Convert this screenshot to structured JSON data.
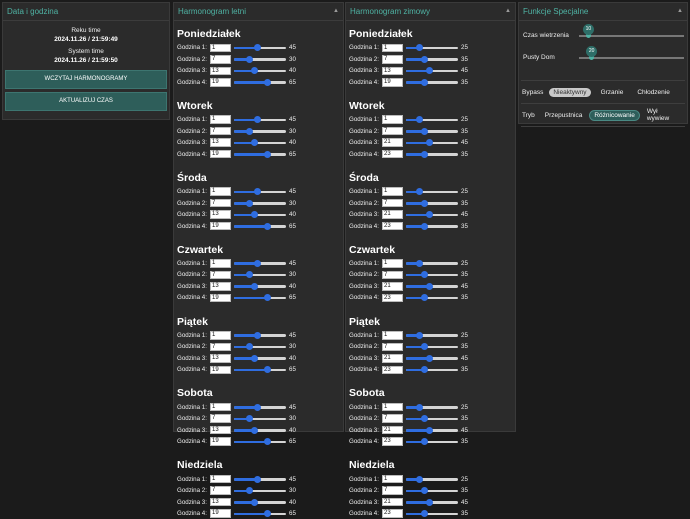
{
  "datetime": {
    "header": "Data i godzina",
    "reku_label": "Reku time",
    "reku_value": "2024.11.26 / 21:59:49",
    "system_label": "System time",
    "system_value": "2024.11.26 / 21:59:50",
    "load_button": "WCZYTAJ HARMONOGRAMY",
    "update_button": "AKTUALIZUJ CZAS"
  },
  "summer": {
    "header": "Harmonogram letni",
    "days": [
      {
        "name": "Poniedziałek",
        "rows": [
          {
            "label": "Godzina 1:",
            "hour": "1",
            "value": "45"
          },
          {
            "label": "Godzina 2:",
            "hour": "7",
            "value": "30"
          },
          {
            "label": "Godzina 3:",
            "hour": "13",
            "value": "40"
          },
          {
            "label": "Godzina 4:",
            "hour": "19",
            "value": "65"
          }
        ]
      },
      {
        "name": "Wtorek",
        "rows": [
          {
            "label": "Godzina 1:",
            "hour": "1",
            "value": "45"
          },
          {
            "label": "Godzina 2:",
            "hour": "7",
            "value": "30"
          },
          {
            "label": "Godzina 3:",
            "hour": "13",
            "value": "40"
          },
          {
            "label": "Godzina 4:",
            "hour": "19",
            "value": "65"
          }
        ]
      },
      {
        "name": "Środa",
        "rows": [
          {
            "label": "Godzina 1:",
            "hour": "1",
            "value": "45"
          },
          {
            "label": "Godzina 2:",
            "hour": "7",
            "value": "30"
          },
          {
            "label": "Godzina 3:",
            "hour": "13",
            "value": "40"
          },
          {
            "label": "Godzina 4:",
            "hour": "19",
            "value": "65"
          }
        ]
      },
      {
        "name": "Czwartek",
        "rows": [
          {
            "label": "Godzina 1:",
            "hour": "1",
            "value": "45"
          },
          {
            "label": "Godzina 2:",
            "hour": "7",
            "value": "30"
          },
          {
            "label": "Godzina 3:",
            "hour": "13",
            "value": "40"
          },
          {
            "label": "Godzina 4:",
            "hour": "19",
            "value": "65"
          }
        ]
      },
      {
        "name": "Piątek",
        "rows": [
          {
            "label": "Godzina 1:",
            "hour": "1",
            "value": "45"
          },
          {
            "label": "Godzina 2:",
            "hour": "7",
            "value": "30"
          },
          {
            "label": "Godzina 3:",
            "hour": "13",
            "value": "40"
          },
          {
            "label": "Godzina 4:",
            "hour": "19",
            "value": "65"
          }
        ]
      },
      {
        "name": "Sobota",
        "rows": [
          {
            "label": "Godzina 1:",
            "hour": "1",
            "value": "45"
          },
          {
            "label": "Godzina 2:",
            "hour": "7",
            "value": "30"
          },
          {
            "label": "Godzina 3:",
            "hour": "13",
            "value": "40"
          },
          {
            "label": "Godzina 4:",
            "hour": "19",
            "value": "65"
          }
        ]
      },
      {
        "name": "Niedziela",
        "rows": [
          {
            "label": "Godzina 1:",
            "hour": "1",
            "value": "45"
          },
          {
            "label": "Godzina 2:",
            "hour": "7",
            "value": "30"
          },
          {
            "label": "Godzina 3:",
            "hour": "13",
            "value": "40"
          },
          {
            "label": "Godzina 4:",
            "hour": "19",
            "value": "65"
          }
        ]
      }
    ]
  },
  "winter": {
    "header": "Harmonogram zimowy",
    "days": [
      {
        "name": "Poniedziałek",
        "rows": [
          {
            "label": "Godzina 1:",
            "hour": "1",
            "value": "25"
          },
          {
            "label": "Godzina 2:",
            "hour": "7",
            "value": "35"
          },
          {
            "label": "Godzina 3:",
            "hour": "13",
            "value": "45"
          },
          {
            "label": "Godzina 4:",
            "hour": "19",
            "value": "35"
          }
        ]
      },
      {
        "name": "Wtorek",
        "rows": [
          {
            "label": "Godzina 1:",
            "hour": "1",
            "value": "25"
          },
          {
            "label": "Godzina 2:",
            "hour": "7",
            "value": "35"
          },
          {
            "label": "Godzina 3:",
            "hour": "21",
            "value": "45"
          },
          {
            "label": "Godzina 4:",
            "hour": "23",
            "value": "35"
          }
        ]
      },
      {
        "name": "Środa",
        "rows": [
          {
            "label": "Godzina 1:",
            "hour": "1",
            "value": "25"
          },
          {
            "label": "Godzina 2:",
            "hour": "7",
            "value": "35"
          },
          {
            "label": "Godzina 3:",
            "hour": "21",
            "value": "45"
          },
          {
            "label": "Godzina 4:",
            "hour": "23",
            "value": "35"
          }
        ]
      },
      {
        "name": "Czwartek",
        "rows": [
          {
            "label": "Godzina 1:",
            "hour": "1",
            "value": "25"
          },
          {
            "label": "Godzina 2:",
            "hour": "7",
            "value": "35"
          },
          {
            "label": "Godzina 3:",
            "hour": "21",
            "value": "45"
          },
          {
            "label": "Godzina 4:",
            "hour": "23",
            "value": "35"
          }
        ]
      },
      {
        "name": "Piątek",
        "rows": [
          {
            "label": "Godzina 1:",
            "hour": "1",
            "value": "25"
          },
          {
            "label": "Godzina 2:",
            "hour": "7",
            "value": "35"
          },
          {
            "label": "Godzina 3:",
            "hour": "21",
            "value": "45"
          },
          {
            "label": "Godzina 4:",
            "hour": "23",
            "value": "35"
          }
        ]
      },
      {
        "name": "Sobota",
        "rows": [
          {
            "label": "Godzina 1:",
            "hour": "1",
            "value": "25"
          },
          {
            "label": "Godzina 2:",
            "hour": "7",
            "value": "35"
          },
          {
            "label": "Godzina 3:",
            "hour": "21",
            "value": "45"
          },
          {
            "label": "Godzina 4:",
            "hour": "23",
            "value": "35"
          }
        ]
      },
      {
        "name": "Niedziela",
        "rows": [
          {
            "label": "Godzina 1:",
            "hour": "1",
            "value": "25"
          },
          {
            "label": "Godzina 2:",
            "hour": "7",
            "value": "35"
          },
          {
            "label": "Godzina 3:",
            "hour": "21",
            "value": "45"
          },
          {
            "label": "Godzina 4:",
            "hour": "23",
            "value": "35"
          }
        ]
      }
    ]
  },
  "special": {
    "header": "Funkcje Specjalne",
    "ventilation_label": "Czas wietrzenia",
    "ventilation_value": "10",
    "empty_house_label": "Pusty Dom",
    "empty_house_value": "20",
    "bypass_label": "Bypass",
    "bypass_options": [
      "Nieaktywny",
      "Grzanie",
      "Chłodzenie"
    ],
    "bypass_selected": "Nieaktywny",
    "mode_label": "Tryb",
    "mode_options": [
      "Przepustnica",
      "Różnicowanie",
      "Wył wywiew"
    ],
    "mode_selected": "Różnicowanie"
  },
  "colors": {
    "accent": "#4fb3a4",
    "slider": "#2f6de0",
    "button": "#2e5e5a"
  }
}
